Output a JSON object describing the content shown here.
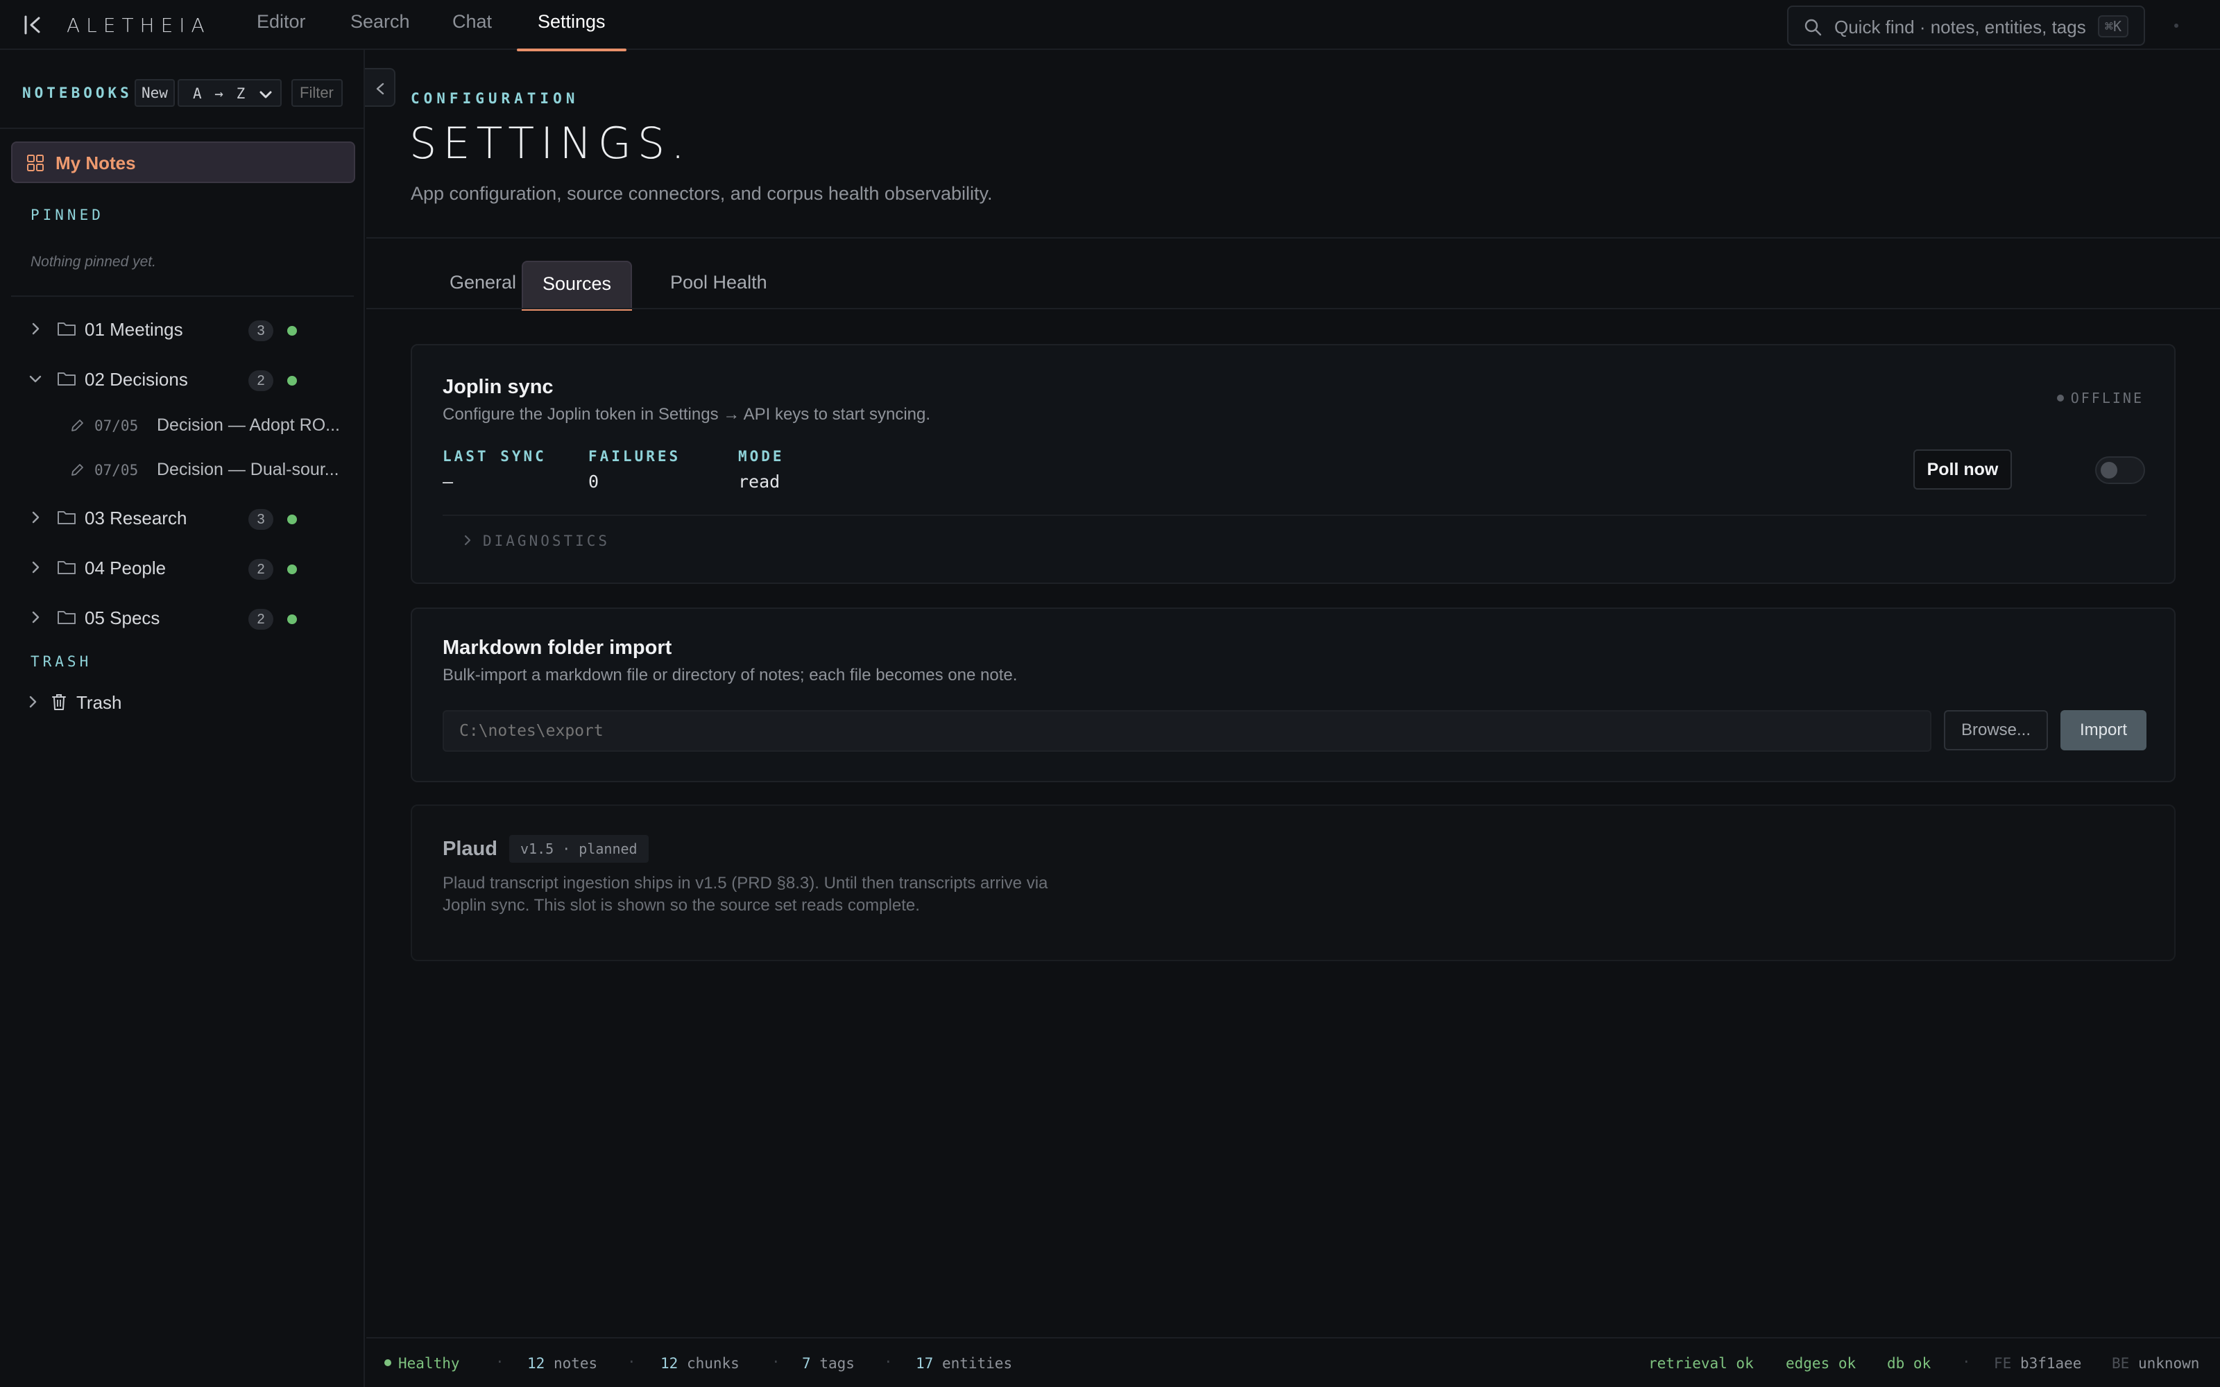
{
  "app": {
    "brand": "ALETHEIA",
    "nav": [
      {
        "label": "Editor"
      },
      {
        "label": "Search"
      },
      {
        "label": "Chat"
      },
      {
        "label": "Settings",
        "active": true
      }
    ],
    "quick_find": {
      "placeholder": "Quick find · notes, entities, tags",
      "shortcut": "⌘K"
    },
    "accent_color": "#e8906a"
  },
  "sidebar": {
    "title": "NOTEBOOKS",
    "new_label": "New",
    "sort": {
      "selected": "A → Z"
    },
    "filter_placeholder": "Filter",
    "my_notes_label": "My Notes",
    "pinned_label": "PINNED",
    "pinned_empty": "Nothing pinned yet.",
    "folders": [
      {
        "label": "01 Meetings",
        "count": "3",
        "expanded": false
      },
      {
        "label": "02 Decisions",
        "count": "2",
        "expanded": true,
        "notes": [
          {
            "date": "07/05",
            "title": "Decision — Adopt RO..."
          },
          {
            "date": "07/05",
            "title": "Decision — Dual-sour..."
          }
        ]
      },
      {
        "label": "03 Research",
        "count": "3",
        "expanded": false
      },
      {
        "label": "04 People",
        "count": "2",
        "expanded": false
      },
      {
        "label": "05 Specs",
        "count": "2",
        "expanded": false
      }
    ],
    "trash_section": "TRASH",
    "trash_label": "Trash"
  },
  "main": {
    "eyebrow": "CONFIGURATION",
    "title": "SETTINGS.",
    "subtitle": "App configuration, source connectors, and corpus health observability.",
    "tabs": [
      {
        "label": "General"
      },
      {
        "label": "Sources",
        "active": true
      },
      {
        "label": "Pool Health"
      }
    ],
    "joplin": {
      "title": "Joplin sync",
      "description": "Configure the Joplin token in Settings → API keys to start syncing.",
      "status": "OFFLINE",
      "stats": [
        {
          "key": "LAST SYNC",
          "value": "—"
        },
        {
          "key": "FAILURES",
          "value": "0"
        },
        {
          "key": "MODE",
          "value": "read"
        }
      ],
      "poll_label": "Poll now",
      "enabled": false,
      "diagnostics_label": "DIAGNOSTICS"
    },
    "markdown": {
      "title": "Markdown folder import",
      "description": "Bulk-import a markdown file or directory of notes; each file becomes one note.",
      "path_placeholder": "C:\\notes\\export",
      "browse_label": "Browse...",
      "import_label": "Import"
    },
    "plaud": {
      "title": "Plaud",
      "badge": "v1.5 · planned",
      "description_line1": "Plaud transcript ingestion ships in v1.5 (PRD §8.3). Until then transcripts arrive via",
      "description_line2": "Joplin sync. This slot is shown so the source set reads complete."
    }
  },
  "statusbar": {
    "health": "Healthy",
    "notes": {
      "n": "12",
      "label": "notes"
    },
    "chunks": {
      "n": "12",
      "label": "chunks"
    },
    "tags": {
      "n": "7",
      "label": "tags"
    },
    "entities": {
      "n": "17",
      "label": "entities"
    },
    "checks": [
      "retrieval ok",
      "edges ok",
      "db ok"
    ],
    "fe": {
      "label": "FE",
      "value": "b3f1aee"
    },
    "be": {
      "label": "BE",
      "value": "unknown"
    }
  }
}
